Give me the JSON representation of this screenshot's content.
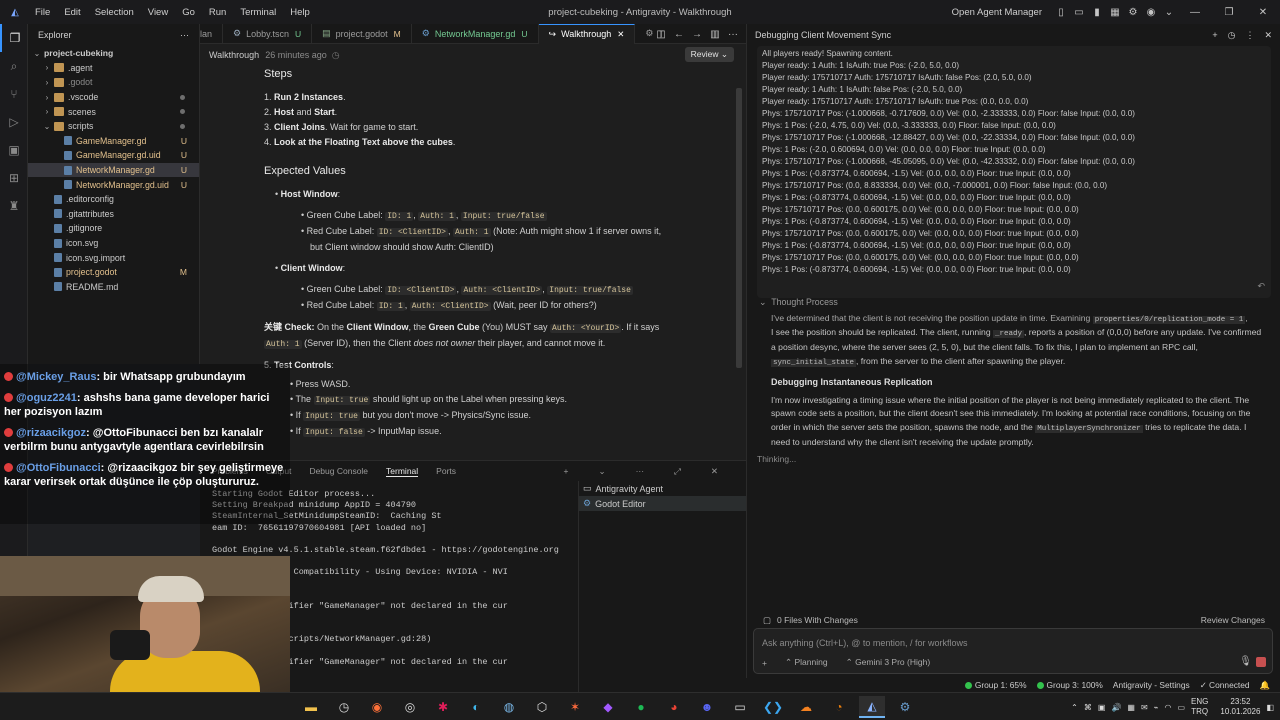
{
  "window_title": "project-cubeking - Antigravity - Walkthrough",
  "menu": [
    "File",
    "Edit",
    "Selection",
    "View",
    "Go",
    "Run",
    "Terminal",
    "Help"
  ],
  "open_agent_manager": "Open Agent Manager",
  "explorer": {
    "title": "Explorer",
    "root": "project-cubeking",
    "items": [
      {
        "label": ".agent",
        "kind": "folder",
        "status": ""
      },
      {
        "label": ".godot",
        "kind": "folder",
        "status": "",
        "dim": true
      },
      {
        "label": ".vscode",
        "kind": "folder",
        "status": "dot"
      },
      {
        "label": "scenes",
        "kind": "folder",
        "status": "dot"
      },
      {
        "label": "scripts",
        "kind": "folder-open",
        "status": "dot"
      },
      {
        "label": "GameManager.gd",
        "kind": "file",
        "status": "U",
        "indent": 2
      },
      {
        "label": "GameManager.gd.uid",
        "kind": "file",
        "status": "U",
        "indent": 2
      },
      {
        "label": "NetworkManager.gd",
        "kind": "file",
        "status": "U",
        "indent": 2,
        "selected": true
      },
      {
        "label": "NetworkManager.gd.uid",
        "kind": "file",
        "status": "U",
        "indent": 2
      },
      {
        "label": ".editorconfig",
        "kind": "file",
        "status": ""
      },
      {
        "label": ".gitattributes",
        "kind": "file",
        "status": ""
      },
      {
        "label": ".gitignore",
        "kind": "file",
        "status": ""
      },
      {
        "label": "icon.svg",
        "kind": "file",
        "status": ""
      },
      {
        "label": "icon.svg.import",
        "kind": "file",
        "status": ""
      },
      {
        "label": "project.godot",
        "kind": "file",
        "status": "M"
      },
      {
        "label": "README.md",
        "kind": "file",
        "status": ""
      }
    ]
  },
  "tabs": [
    {
      "label": "lan",
      "status": ""
    },
    {
      "label": "Lobby.tscn",
      "status": "U"
    },
    {
      "label": "project.godot",
      "status": "M"
    },
    {
      "label": "NetworkManager.gd",
      "status": "U"
    },
    {
      "label": "Walkthrough",
      "status": "",
      "active": true
    },
    {
      "label": "T",
      "status": ""
    }
  ],
  "breadcrumb": {
    "title": "Walkthrough",
    "time": "26 minutes ago",
    "review": "Review"
  },
  "doc": {
    "steps_title": "Steps",
    "steps": [
      {
        "n": "1.",
        "b": "Run 2 Instances",
        "t": "."
      },
      {
        "n": "2.",
        "b": "Host",
        "m": " and ",
        "b2": "Start",
        "t": "."
      },
      {
        "n": "3.",
        "b": "Client Joins",
        "t": ". Wait for game to start."
      },
      {
        "n": "4.",
        "b": "Look at the Floating Text above the cubes",
        "t": "."
      }
    ],
    "expected_title": "Expected Values",
    "host_window": "Host Window",
    "client_window": "Client Window",
    "green_label": "Green Cube Label:",
    "red_label": "Red Cube Label:",
    "h_g1": "ID: 1",
    "h_g2": "Auth: 1",
    "h_g3": "Input: true/false",
    "h_r1": "ID: <ClientID>",
    "h_r2": "Auth: 1",
    "h_r_note": "(Note: Auth might show 1 if server owns it,",
    "h_r_note2": "but Client window should show Auth: ClientID)",
    "c_g1": "ID: <ClientID>",
    "c_g2": "Auth: <ClientID>",
    "c_g3": "Input: true/false",
    "c_r1": "ID: 1",
    "c_r2": "Auth: <ClientID>",
    "c_r_note": "(Wait, peer ID for others?)",
    "key_prefix": "关键 Check:",
    "key_a": " On the ",
    "key_cw": "Client Window",
    "key_b": ", the ",
    "key_gc": "Green Cube",
    "key_c": " (You) MUST say ",
    "key_code": "Auth: <YourID>",
    "key_d": ". If it says",
    "key_code2": "Auth: 1",
    "key_e": " (Server ID), then the Client ",
    "key_i": "does not owner",
    "key_f": " their player, and cannot move it.",
    "test_n": "5.",
    "test_title": "Test Controls",
    "t1": "Press WASD.",
    "t2a": "The ",
    "t2code": "Input: true",
    "t2b": " should light up on the Label when pressing keys.",
    "t3a": "If ",
    "t3code": "Input: true",
    "t3b": " but you don't move -> Physics/Sync issue.",
    "t4a": "If ",
    "t4code": "Input: false",
    "t4b": " -> InputMap issue."
  },
  "panel": {
    "tabs": [
      "Problems",
      "Output",
      "Debug Console",
      "Terminal",
      "Ports"
    ],
    "active": "Terminal",
    "terminal_lines": [
      "Starting Godot Editor process...",
      "Setting Breakpad minidump AppID = 404790",
      "SteamInternal_SetMinidumpSteamID:  Caching St",
      "eam ID:  76561197970604981 [API loaded no]",
      "",
      "Godot Engine v4.5.1.stable.steam.f62fdbde1 - https://godotengine.org",
      "",
      "NVIDIA 591.59 - Compatibility - Using Device: NVIDIA - NVI",
      "080",
      "",
      "se Error: Identifier \"GameManager\" not declared in the cur",
      "",
      "",
      "reload (res://scripts/NetworkManager.gd:28)",
      "",
      "se Error: Identifier \"GameManager\" not declared in the cur"
    ],
    "term_list": [
      "Antigravity Agent",
      "Godot Editor"
    ]
  },
  "chat": {
    "title": "Debugging Client Movement Sync",
    "log": [
      "All players ready! Spawning content.",
      "Player ready: 1 Auth: 1 IsAuth: true Pos: (-2.0, 5.0, 0.0)",
      "Player ready: 175710717 Auth: 175710717 IsAuth: false Pos: (2.0, 5.0, 0.0)",
      "Player ready: 1 Auth: 1 IsAuth: false Pos: (-2.0, 5.0, 0.0)",
      "Player ready: 175710717 Auth: 175710717 IsAuth: true Pos: (0.0, 0.0, 0.0)",
      "Phys: 175710717 Pos: (-1.000668, -0.717609, 0.0) Vel: (0.0, -2.333333, 0.0) Floor: false Input: (0.0, 0.0)",
      "Phys: 1 Pos: (-2.0, 4.75, 0.0) Vel: (0.0, -3.333333, 0.0) Floor: false Input: (0.0, 0.0)",
      "Phys: 175710717 Pos: (-1.000668, -12.88427, 0.0) Vel: (0.0, -22.33334, 0.0) Floor: false Input: (0.0, 0.0)",
      "Phys: 1 Pos: (-2.0, 0.600694, 0.0) Vel: (0.0, 0.0, 0.0) Floor: true Input: (0.0, 0.0)",
      "Phys: 175710717 Pos: (-1.000668, -45.05095, 0.0) Vel: (0.0, -42.33332, 0.0) Floor: false Input: (0.0, 0.0)",
      "Phys: 1 Pos: (-0.873774, 0.600694, -1.5) Vel: (0.0, 0.0, 0.0) Floor: true Input: (0.0, 0.0)",
      "Phys: 175710717 Pos: (0.0, 8.833334, 0.0) Vel: (0.0, -7.000001, 0.0) Floor: false Input: (0.0, 0.0)",
      "Phys: 1 Pos: (-0.873774, 0.600694, -1.5) Vel: (0.0, 0.0, 0.0) Floor: true Input: (0.0, 0.0)",
      "Phys: 175710717 Pos: (0.0, 0.600175, 0.0) Vel: (0.0, 0.0, 0.0) Floor: true Input: (0.0, 0.0)",
      "Phys: 1 Pos: (-0.873774, 0.600694, -1.5) Vel: (0.0, 0.0, 0.0) Floor: true Input: (0.0, 0.0)",
      "Phys: 175710717 Pos: (0.0, 0.600175, 0.0) Vel: (0.0, 0.0, 0.0) Floor: true Input: (0.0, 0.0)",
      "Phys: 1 Pos: (-0.873774, 0.600694, -1.5) Vel: (0.0, 0.0, 0.0) Floor: true Input: (0.0, 0.0)",
      "Phys: 175710717 Pos: (0.0, 0.600175, 0.0) Vel: (0.0, 0.0, 0.0) Floor: true Input: (0.0, 0.0)",
      "Phys: 1 Pos: (-0.873774, 0.600694, -1.5) Vel: (0.0, 0.0, 0.0) Floor: true Input: (0.0, 0.0)"
    ],
    "thought_title": "Thought Process",
    "p1_a": "I've determined that the client is not receiving the position update in time. Examining ",
    "p1_code": "properties/0/replication_mode = 1",
    "p1_b": ",",
    "p2_a": "I see the position should be replicated. The client, running ",
    "p2_code": "_ready",
    "p2_b": ", reports a position of (0,0,0) before any update. I've confirmed a position desync, where the server sees (2, 5, 0), but the client falls. To fix this, I plan to implement an RPC call, ",
    "p2_code2": "sync_initial_state",
    "p2_c": ", from the server to the client after spawning the player.",
    "h2": "Debugging Instantaneous Replication",
    "p3_a": "I'm now investigating a timing issue where the initial position of the player is not being immediately replicated to the client. The spawn code sets a position, but the client doesn't see this immediately. I'm looking at potential race conditions, focusing on the order in which the server sets the position, spawns the node, and the ",
    "p3_code": "MultiplayerSynchronizer",
    "p3_b": " tries to replicate the data. I need to understand why the client isn't receiving the update promptly.",
    "thinking": "Thinking...",
    "files_changes": "0 Files With Changes",
    "review_changes": "Review Changes",
    "input_placeholder": "Ask anything (Ctrl+L), @ to mention, / for workflows",
    "plus": "+",
    "mode": "Planning",
    "model": "Gemini 3 Pro (High)"
  },
  "status": {
    "g1": "Group 1: 65%",
    "g3": "Group 3: 100%",
    "settings": "Antigravity - Settings",
    "connected": "Connected"
  },
  "stream_chat": [
    {
      "user": "@Mickey_Raus",
      "text": ": bir Whatsapp grubundayım"
    },
    {
      "user": "@oguz2241",
      "text": ": ashshs bana game developer harici her pozisyon lazım"
    },
    {
      "user": "@rizaacikgoz",
      "text": ": @OttoFibunacci ben bzı kanalalr verbilrm bunu antygavtyle agentlara cevirlebilrsin"
    },
    {
      "user": "@OttoFibunacci",
      "text": ": @rizaacikgoz bir şey geliştirmeye karar verirsek ortak düşünce ile çöp oluştururuz."
    }
  ],
  "tray": {
    "lang1": "ENG",
    "lang2": "TRQ",
    "time": "23:52",
    "date": "10.01.2026"
  }
}
